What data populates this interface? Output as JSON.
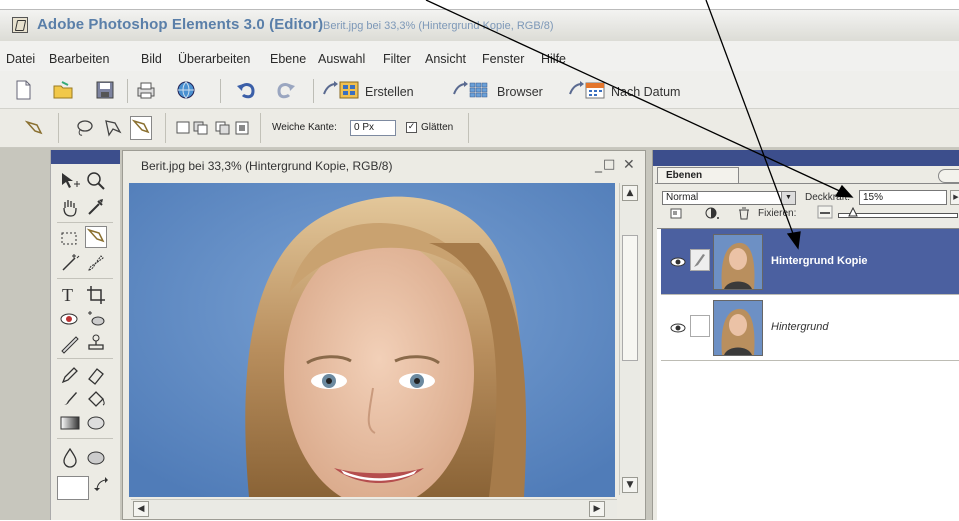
{
  "titlebar": {
    "app_title": "Adobe Photoshop Elements 3.0 (Editor)",
    "doc_title": "Berit.jpg bei 33,3% (Hintergrund Kopie, RGB/8)"
  },
  "menu": {
    "items": [
      "Datei",
      "Bearbeiten",
      "Bild",
      "Überarbeiten",
      "Ebene",
      "Auswahl",
      "Filter",
      "Ansicht",
      "Fenster",
      "Hilfe"
    ]
  },
  "toolbar": {
    "create_label": "Erstellen",
    "browser_label": "Browser",
    "by_date_label": "Nach Datum"
  },
  "options": {
    "feather_label": "Weiche Kante:",
    "feather_value": "0 Px",
    "smooth_label": "Glätten",
    "smooth_checked": "✓"
  },
  "document": {
    "title": "Berit.jpg bei 33,3% (Hintergrund Kopie, RGB/8)",
    "minimize": "_",
    "maximize": "□",
    "close": "✕"
  },
  "layers_panel": {
    "tab_label": "Ebenen",
    "blend_mode": "Normal",
    "opacity_label": "Deckkraft:",
    "opacity_value": "15%",
    "lock_label": "Fixieren:",
    "opacity_fraction": 0.15,
    "layers": [
      {
        "name": "Hintergrund Kopie",
        "selected": true
      },
      {
        "name": "Hintergrund",
        "selected": false
      }
    ]
  },
  "colors": {
    "accent_blue": "#3c4e8c",
    "selected_row": "#4b60a0",
    "title_blue": "#5a7fa9",
    "canvas_bg": "#5f88c0"
  }
}
